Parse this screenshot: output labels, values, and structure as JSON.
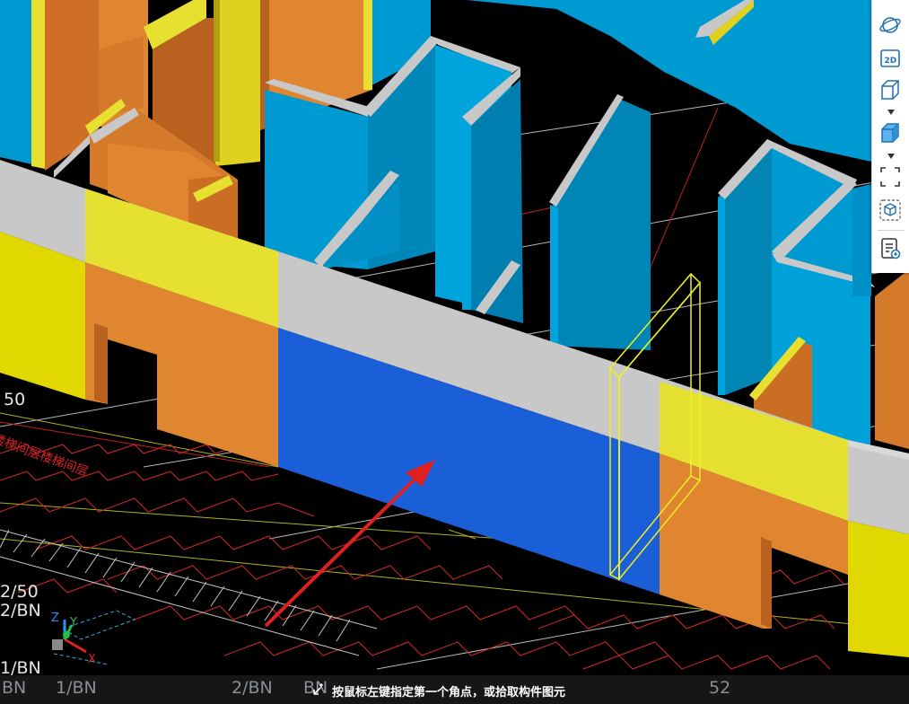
{
  "viewport": {
    "grid_labels": {
      "left_50": "50",
      "left_2_50": "2/50",
      "left_2_BN": "2/BN",
      "left_1_BN": "1/BN"
    },
    "bottom_labels": [
      "BN",
      "1/BN",
      "2/BN",
      "BN",
      "52"
    ],
    "annotation_text": "楼梯间层楼梯间层",
    "axis": {
      "x": "X",
      "y": "Y",
      "z": "Z"
    }
  },
  "toolbar": {
    "items": [
      {
        "name": "orbit",
        "icon": "orbit-icon"
      },
      {
        "name": "2d-view",
        "icon": "2d-view-icon",
        "label": "2D"
      },
      {
        "name": "3d-view",
        "icon": "cube-wireframe-icon"
      },
      {
        "name": "3d-solid",
        "icon": "cube-solid-icon"
      },
      {
        "name": "zoom-extent",
        "icon": "zoom-extent-icon"
      },
      {
        "name": "selection-box",
        "icon": "selection-cube-icon"
      },
      {
        "name": "view-properties",
        "icon": "document-view-icon"
      }
    ]
  },
  "status_bar": {
    "message": "按鼠标左键指定第一个角点，或拾取构件图元"
  },
  "colors": {
    "background": "#000000",
    "wall_blue": "#0098d0",
    "wall_orange": "#e08530",
    "wall_yellow": "#e8e030",
    "wall_gray": "#c8c8c8",
    "selected_wall": "#1a5ed8",
    "highlight": "#f0f020",
    "arrow": "#e02020",
    "toolbar_accent": "#1f6fb5"
  }
}
